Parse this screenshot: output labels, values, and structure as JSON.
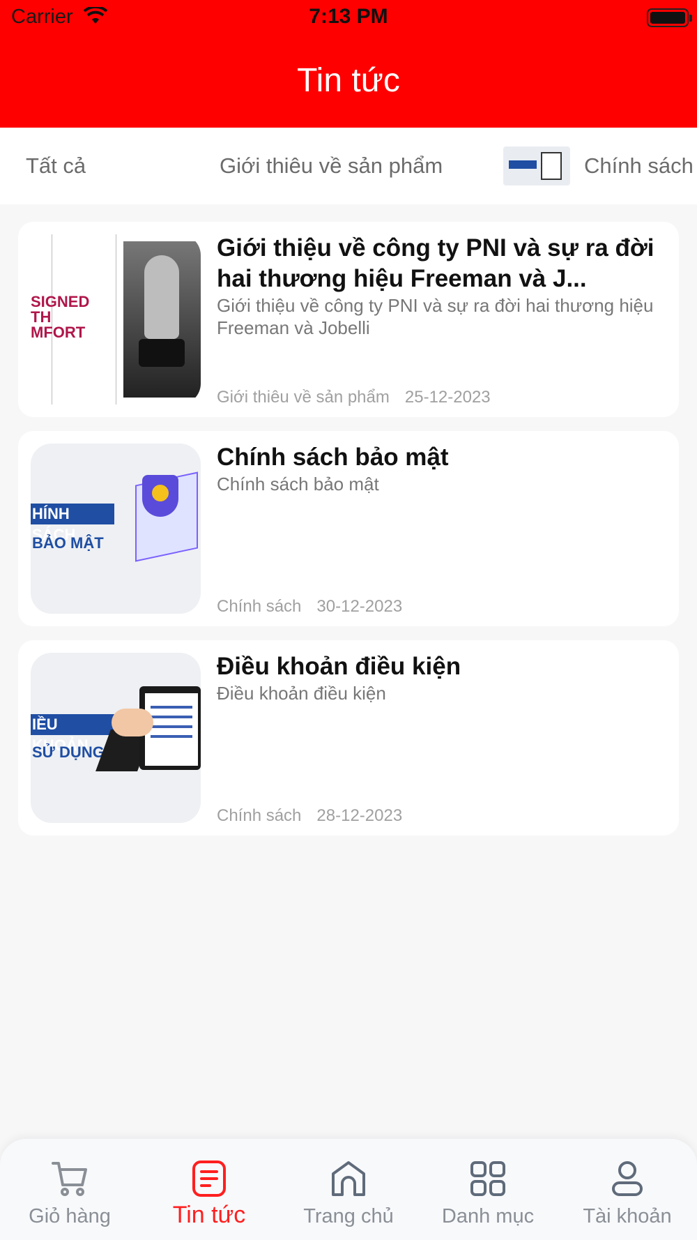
{
  "status_bar": {
    "carrier": "Carrier",
    "time": "7:13 PM"
  },
  "header": {
    "title": "Tin tức"
  },
  "tabs": [
    {
      "label": "Tất cả"
    },
    {
      "label": "Giới thiêu về sản phẩm"
    },
    {
      "label": "Chính sách"
    }
  ],
  "articles": [
    {
      "title": "Giới thiệu về công ty PNI và sự ra đời hai thương hiệu Freeman và J...",
      "description": "Giới thiệu về công ty PNI và sự ra đời hai thương hiệu Freeman và Jobelli",
      "category": "Giới thiêu về sản phẩm",
      "date": "25-12-2023",
      "thumb_text": [
        "SIGNED",
        "TH",
        "MFORT"
      ]
    },
    {
      "title": "Chính sách bảo mật",
      "description": "Chính sách bảo mật",
      "category": "Chính sách",
      "date": "30-12-2023",
      "thumb_text": [
        "HÍNH SÁCH",
        "BẢO MẬT"
      ]
    },
    {
      "title": "Điều khoản điều kiện",
      "description": "Điều khoản điều kiện",
      "category": "Chính sách",
      "date": "28-12-2023",
      "thumb_text": [
        "IỀU KHOẢN",
        "SỬ DỤNG"
      ]
    }
  ],
  "bottom_nav": [
    {
      "label": "Giỏ hàng",
      "icon": "cart-icon"
    },
    {
      "label": "Tin tức",
      "icon": "news-icon",
      "active": true
    },
    {
      "label": "Trang chủ",
      "icon": "home-icon"
    },
    {
      "label": "Danh mục",
      "icon": "grid-icon"
    },
    {
      "label": "Tài khoản",
      "icon": "user-icon"
    }
  ],
  "colors": {
    "brand": "#ff0000",
    "inactive": "#8a8f96"
  }
}
